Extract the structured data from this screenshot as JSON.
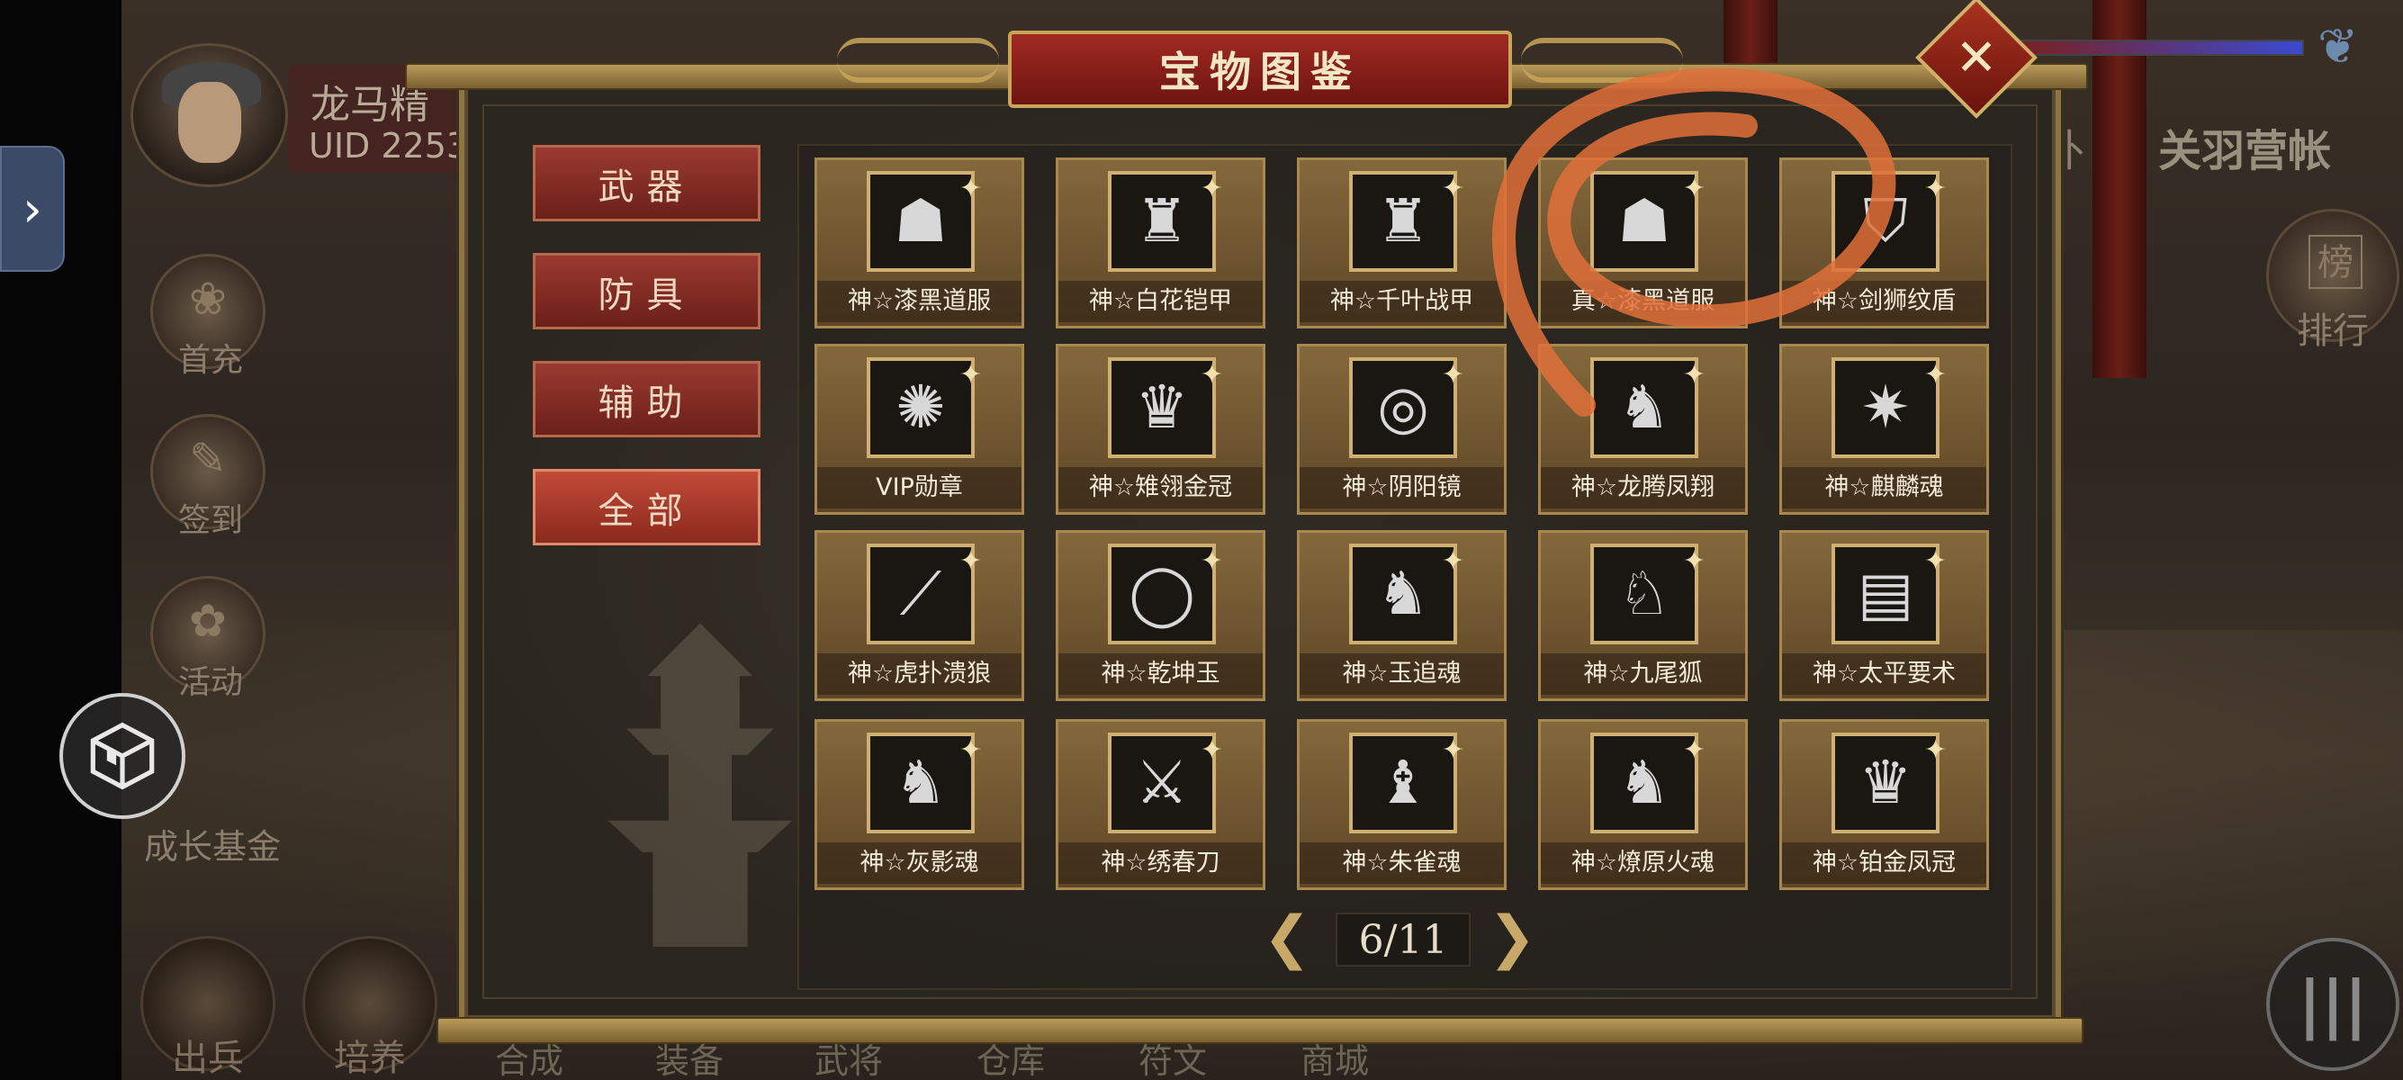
{
  "window": {
    "title": "宝物图鉴"
  },
  "player": {
    "name": "龙马精",
    "uid": "UID  2253"
  },
  "side_menu": {
    "toggle_icon": "chevron-right-icon",
    "items": [
      {
        "label": "首充"
      },
      {
        "label": "签到"
      },
      {
        "label": "活动"
      },
      {
        "label": "成长基金"
      }
    ]
  },
  "right_menu": {
    "tab_1": "外",
    "tab_2": "关羽营帐",
    "rank_label": "排行",
    "rank_glyph": "榜",
    "menu_glyph": "|||"
  },
  "bottom_nav": {
    "circles": [
      {
        "label": "出兵"
      },
      {
        "label": "培养"
      }
    ],
    "items": [
      "合成",
      "装备",
      "武将",
      "仓库",
      "符文",
      "商城"
    ]
  },
  "categories": [
    {
      "label": "武器",
      "active": false
    },
    {
      "label": "防具",
      "active": false
    },
    {
      "label": "辅助",
      "active": false
    },
    {
      "label": "全部",
      "active": true
    }
  ],
  "items": [
    {
      "name": "神☆漆黑道服",
      "icon": "robe-icon",
      "glyph": "☗"
    },
    {
      "name": "神☆白花铠甲",
      "icon": "armor-icon",
      "glyph": "♜"
    },
    {
      "name": "神☆千叶战甲",
      "icon": "armor-icon",
      "glyph": "♜"
    },
    {
      "name": "真☆漆黑道服",
      "icon": "robe-icon",
      "glyph": "☗"
    },
    {
      "name": "神☆剑狮纹盾",
      "icon": "shield-icon",
      "glyph": "⛉"
    },
    {
      "name": "VIP勋章",
      "icon": "medal-icon",
      "glyph": "✺"
    },
    {
      "name": "神☆雉翎金冠",
      "icon": "crown-icon",
      "glyph": "♛"
    },
    {
      "name": "神☆阴阳镜",
      "icon": "mirror-icon",
      "glyph": "◎"
    },
    {
      "name": "神☆龙腾凤翔",
      "icon": "dragon-icon",
      "glyph": "♞"
    },
    {
      "name": "神☆麒麟魂",
      "icon": "qilin-icon",
      "glyph": "✷"
    },
    {
      "name": "神☆虎扑溃狼",
      "icon": "spear-icon",
      "glyph": "⟋"
    },
    {
      "name": "神☆乾坤玉",
      "icon": "jade-ring-icon",
      "glyph": "◯"
    },
    {
      "name": "神☆玉追魂",
      "icon": "horse-icon",
      "glyph": "♞"
    },
    {
      "name": "神☆九尾狐",
      "icon": "fox-icon",
      "glyph": "♘"
    },
    {
      "name": "神☆太平要术",
      "icon": "book-icon",
      "glyph": "▤"
    },
    {
      "name": "神☆灰影魂",
      "icon": "horse-icon",
      "glyph": "♞"
    },
    {
      "name": "神☆绣春刀",
      "icon": "swords-icon",
      "glyph": "⚔"
    },
    {
      "name": "神☆朱雀魂",
      "icon": "phoenix-icon",
      "glyph": "♝"
    },
    {
      "name": "神☆燎原火魂",
      "icon": "horse-icon",
      "glyph": "♞"
    },
    {
      "name": "神☆铂金凤冠",
      "icon": "crown-icon",
      "glyph": "♛"
    }
  ],
  "pagination": {
    "text": "6/11",
    "current": 6,
    "total": 11,
    "prev_icon": "chevron-left-icon",
    "next_icon": "chevron-right-icon"
  },
  "colors": {
    "accent_red": "#a02a22",
    "gold": "#c9a55a",
    "card_bg": "#84683c",
    "scribble": "#e0703a"
  }
}
